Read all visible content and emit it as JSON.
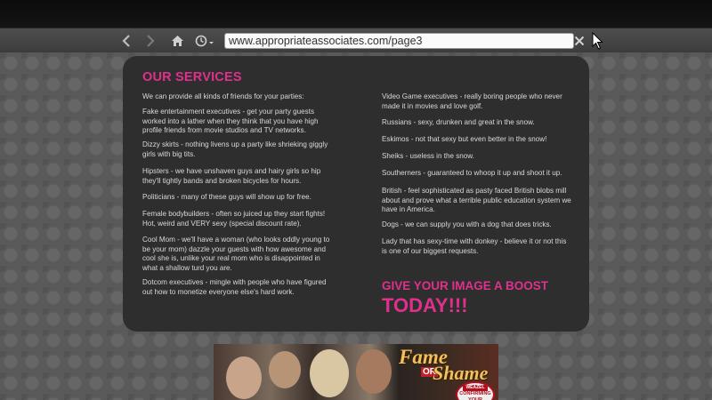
{
  "browser": {
    "url": "www.appropriateassociates.com/page3",
    "icons": [
      "back-arrow-icon",
      "forward-arrow-icon",
      "home-icon",
      "history-clock-icon",
      "close-icon",
      "mouse-cursor-icon"
    ]
  },
  "services": {
    "heading": "OUR SERVICES",
    "intro": "We can provide all kinds of friends for your parties:",
    "left_items": [
      "Fake entertainment executives - get your party guests worked into a lather when they think that you have high profile friends from movie studios and TV networks.",
      "Dizzy skirts - nothing livens up a party like shrieking giggly girls with big tits.",
      "Hipsters - we have unshaven guys and hairy girls so hip they'll tightly bands and broken bicycles for hours.",
      "Politicians - many of these guys will show up for free.",
      "Female bodybuilders - often so juiced up they start fights! Hot, weird and VERY sexy (special discount rate).",
      "Cool Mom - we'll have a woman (who looks oddly young to be your mom) dazzle your guests with how awesome and cool she is, unlike your real mom who is disappointed in what a shallow turd you are.",
      "Dotcom executives - mingle with people who have figured out how to monetize everyone else's hard work."
    ],
    "right_items": [
      "Video Game executives - really boring people who never made it in movies and love golf.",
      "Russians - sexy, drunken and great in the snow.",
      "Eskimos - not that sexy but even better in the snow!",
      "Sheiks - useless in the snow.",
      "Southerners - guaranteed to whoop it up and shoot it up.",
      "British - feel sophisticated as pasty faced British blobs mill about and prove what a terrible public education system we have in America.",
      "Dogs - we can supply you with a dog that does tricks.",
      "Lady that has sexy-time with donkey - believe it or not this is one of our biggest requests."
    ],
    "boost_line1": "GIVE YOUR IMAGE A BOOST",
    "boost_line2": "TODAY!!!"
  },
  "banner": {
    "title_top": "Fame",
    "title_or": "OR",
    "title_bottom": "Shame",
    "badge_brand": "WEAZEL",
    "badge_text": "CONFIRMING YOUR"
  }
}
